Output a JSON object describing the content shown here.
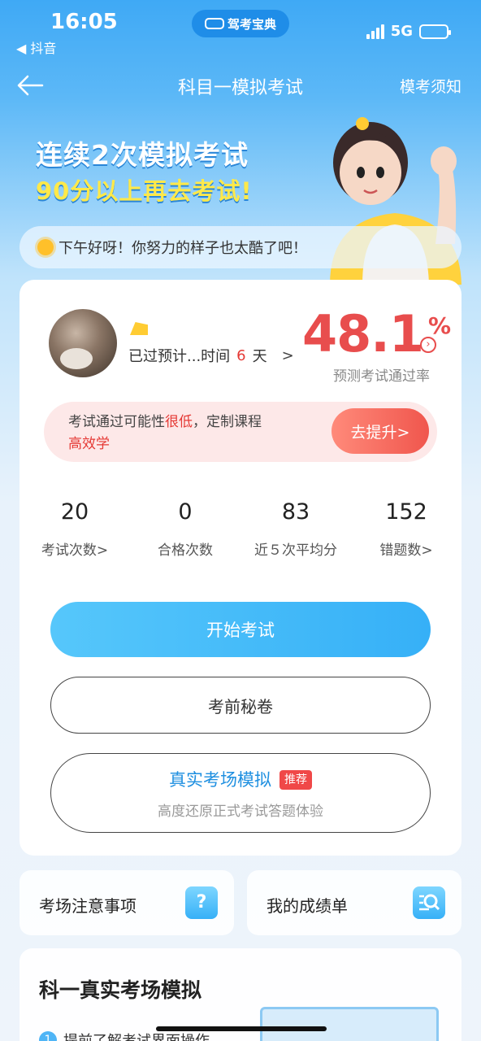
{
  "status": {
    "time": "16:05",
    "back_app": "◀ 抖音",
    "app_pill": "驾考宝典",
    "network": "5G"
  },
  "nav": {
    "title": "科目一模拟考试",
    "notice": "模考须知"
  },
  "hero": {
    "line1": "连续2次模拟考试",
    "line2": "90分以上再去考试!",
    "greeting": "下午好呀！你努力的样子也太酷了吧！"
  },
  "profile": {
    "plan_text": "已过预计...时间",
    "days": "6",
    "days_unit": "天",
    "chev": ">",
    "pass_rate": "48.1",
    "pass_rate_unit": "%",
    "pass_rate_label": "预测考试通过率"
  },
  "improve": {
    "text_a": "考试通过可能性",
    "text_red1": "很低",
    "text_b": "，定制课程",
    "text_red2": "高效学",
    "button": "去提升>"
  },
  "stats": [
    {
      "value": "20",
      "label": "考试次数>"
    },
    {
      "value": "0",
      "label": "合格次数"
    },
    {
      "value": "83",
      "label": "近５次平均分"
    },
    {
      "value": "152",
      "label": "错题数>"
    }
  ],
  "buttons": {
    "start": "开始考试",
    "secret": "考前秘卷",
    "real_title": "真实考场模拟",
    "real_badge": "推荐",
    "real_sub": "高度还原正式考试答题体验"
  },
  "tiles": {
    "notes": "考场注意事项",
    "notes_icon": "?",
    "scores": "我的成绩单"
  },
  "section": {
    "title": "科一真实考场模拟",
    "item_num": "1",
    "item_text": "提前了解考试界面操作"
  },
  "colors": {
    "accent_blue": "#36b0f7",
    "danger_red": "#e84d4d",
    "hero_yellow": "#ffe94a"
  }
}
